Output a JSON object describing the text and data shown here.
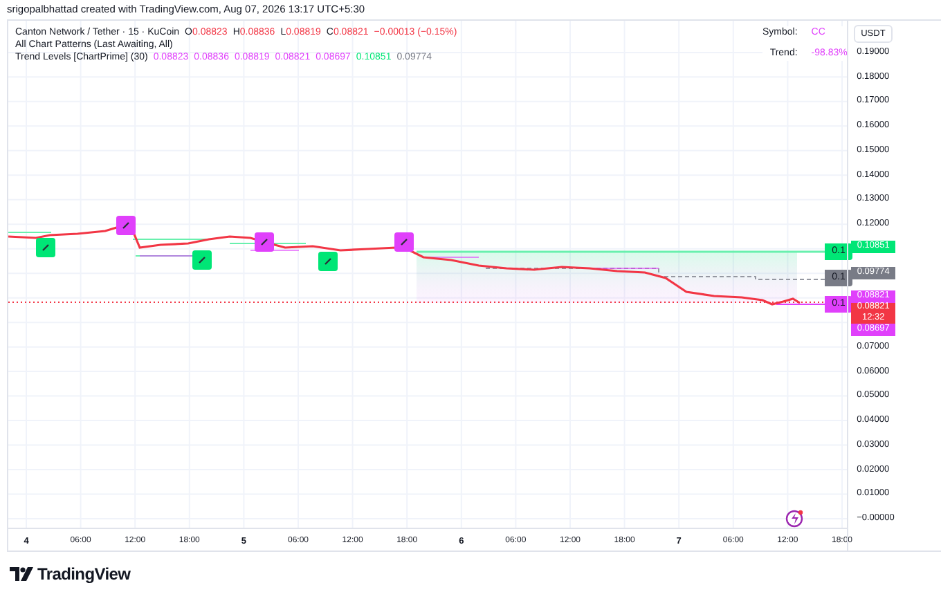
{
  "header": {
    "credit": "srigopalbhattad created with TradingView.com, Aug 07, 2026 13:17 UTC+5:30"
  },
  "legend": {
    "symbol": "Canton Network / Tether · 15 · KuCoin",
    "ohlc": [
      {
        "label": "O",
        "value": "0.08823"
      },
      {
        "label": "H",
        "value": "0.08836"
      },
      {
        "label": "L",
        "value": "0.08819"
      },
      {
        "label": "C",
        "value": "0.08821"
      }
    ],
    "change": "−0.00013 (−0.15%)"
  },
  "indicators": [
    {
      "name": "All Chart Patterns (Last Awaiting, All)"
    },
    {
      "name": "Trend Levels [ChartPrime] (30)",
      "values": [
        {
          "text": "0.08823",
          "color": "#e040fb"
        },
        {
          "text": "0.08836",
          "color": "#e040fb"
        },
        {
          "text": "0.08819",
          "color": "#e040fb"
        },
        {
          "text": "0.08821",
          "color": "#e040fb"
        },
        {
          "text": "0.08697",
          "color": "#e040fb"
        },
        {
          "text": "0.10851",
          "color": "#00e676"
        },
        {
          "text": "0.09774",
          "color": "#787b86"
        }
      ]
    }
  ],
  "info_table": [
    {
      "label": "Symbol:",
      "value": "CC"
    },
    {
      "label": "Trend:",
      "value": "-98.83%"
    }
  ],
  "price_axis": {
    "unit": "USDT",
    "ticks": [
      "0.19000",
      "0.18000",
      "0.17000",
      "0.16000",
      "0.15000",
      "0.14000",
      "0.13000",
      "0.12000",
      "0.07000",
      "0.06000",
      "0.05000",
      "0.04000",
      "0.03000",
      "0.02000",
      "0.01000",
      "−0.00000"
    ]
  },
  "price_badges": [
    {
      "text": "0.10851",
      "color": "#00e676"
    },
    {
      "text": "0.09774",
      "color": "#787b86"
    },
    {
      "text": "0.08821",
      "color": "#e040fb"
    },
    {
      "text": "0.08821",
      "time": "12:32",
      "color": "#f23645"
    },
    {
      "text": "0.08697",
      "color": "#e040fb"
    }
  ],
  "level_tags": [
    {
      "text": "0.1",
      "color": "#00e676"
    },
    {
      "text": "0.1",
      "color": "#787b86"
    },
    {
      "text": "0.1",
      "color": "#e040fb"
    }
  ],
  "time_axis": [
    {
      "label": "4",
      "kind": "day"
    },
    {
      "label": "06:00",
      "kind": "time"
    },
    {
      "label": "12:00",
      "kind": "time"
    },
    {
      "label": "18:00",
      "kind": "time"
    },
    {
      "label": "5",
      "kind": "day"
    },
    {
      "label": "06:00",
      "kind": "time"
    },
    {
      "label": "12:00",
      "kind": "time"
    },
    {
      "label": "18:00",
      "kind": "time"
    },
    {
      "label": "6",
      "kind": "day"
    },
    {
      "label": "06:00",
      "kind": "time"
    },
    {
      "label": "12:00",
      "kind": "time"
    },
    {
      "label": "18:00",
      "kind": "time"
    },
    {
      "label": "7",
      "kind": "day"
    },
    {
      "label": "06:00",
      "kind": "time"
    },
    {
      "label": "12:00",
      "kind": "time"
    },
    {
      "label": "18:00",
      "kind": "time"
    }
  ],
  "footer": {
    "logo": "TradingView"
  }
}
